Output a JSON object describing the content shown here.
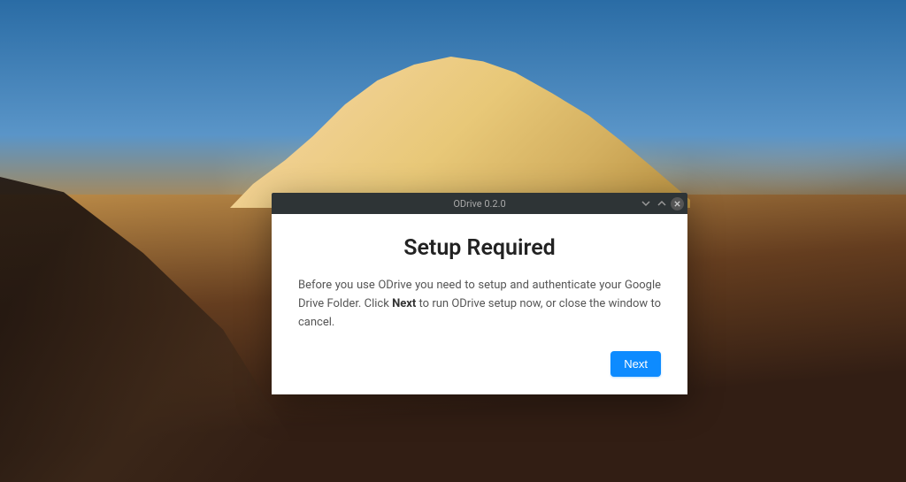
{
  "window": {
    "title": "ODrive 0.2.0"
  },
  "dialog": {
    "heading": "Setup Required",
    "body_before": "Before you use ODrive you need to setup and authenticate your Google Drive Folder. Click ",
    "body_bold": "Next",
    "body_after": " to run ODrive setup now, or close the window to cancel.",
    "next_label": "Next"
  }
}
